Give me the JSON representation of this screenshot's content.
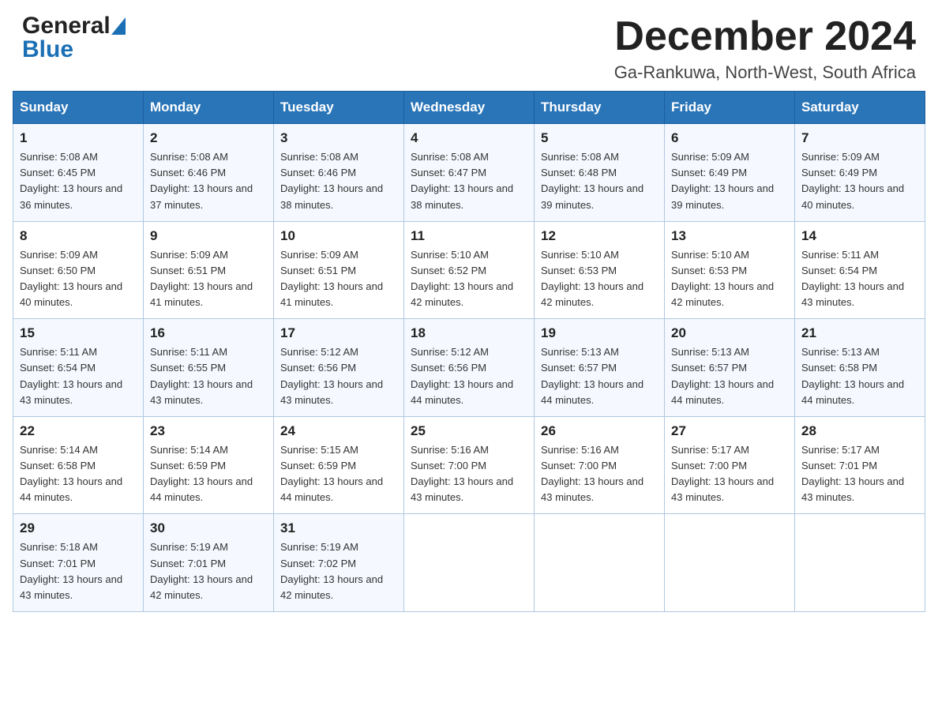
{
  "logo": {
    "general": "General",
    "blue": "Blue"
  },
  "title": {
    "month_year": "December 2024",
    "location": "Ga-Rankuwa, North-West, South Africa"
  },
  "calendar": {
    "headers": [
      "Sunday",
      "Monday",
      "Tuesday",
      "Wednesday",
      "Thursday",
      "Friday",
      "Saturday"
    ],
    "weeks": [
      [
        {
          "day": "1",
          "sunrise": "5:08 AM",
          "sunset": "6:45 PM",
          "daylight": "13 hours and 36 minutes."
        },
        {
          "day": "2",
          "sunrise": "5:08 AM",
          "sunset": "6:46 PM",
          "daylight": "13 hours and 37 minutes."
        },
        {
          "day": "3",
          "sunrise": "5:08 AM",
          "sunset": "6:46 PM",
          "daylight": "13 hours and 38 minutes."
        },
        {
          "day": "4",
          "sunrise": "5:08 AM",
          "sunset": "6:47 PM",
          "daylight": "13 hours and 38 minutes."
        },
        {
          "day": "5",
          "sunrise": "5:08 AM",
          "sunset": "6:48 PM",
          "daylight": "13 hours and 39 minutes."
        },
        {
          "day": "6",
          "sunrise": "5:09 AM",
          "sunset": "6:49 PM",
          "daylight": "13 hours and 39 minutes."
        },
        {
          "day": "7",
          "sunrise": "5:09 AM",
          "sunset": "6:49 PM",
          "daylight": "13 hours and 40 minutes."
        }
      ],
      [
        {
          "day": "8",
          "sunrise": "5:09 AM",
          "sunset": "6:50 PM",
          "daylight": "13 hours and 40 minutes."
        },
        {
          "day": "9",
          "sunrise": "5:09 AM",
          "sunset": "6:51 PM",
          "daylight": "13 hours and 41 minutes."
        },
        {
          "day": "10",
          "sunrise": "5:09 AM",
          "sunset": "6:51 PM",
          "daylight": "13 hours and 41 minutes."
        },
        {
          "day": "11",
          "sunrise": "5:10 AM",
          "sunset": "6:52 PM",
          "daylight": "13 hours and 42 minutes."
        },
        {
          "day": "12",
          "sunrise": "5:10 AM",
          "sunset": "6:53 PM",
          "daylight": "13 hours and 42 minutes."
        },
        {
          "day": "13",
          "sunrise": "5:10 AM",
          "sunset": "6:53 PM",
          "daylight": "13 hours and 42 minutes."
        },
        {
          "day": "14",
          "sunrise": "5:11 AM",
          "sunset": "6:54 PM",
          "daylight": "13 hours and 43 minutes."
        }
      ],
      [
        {
          "day": "15",
          "sunrise": "5:11 AM",
          "sunset": "6:54 PM",
          "daylight": "13 hours and 43 minutes."
        },
        {
          "day": "16",
          "sunrise": "5:11 AM",
          "sunset": "6:55 PM",
          "daylight": "13 hours and 43 minutes."
        },
        {
          "day": "17",
          "sunrise": "5:12 AM",
          "sunset": "6:56 PM",
          "daylight": "13 hours and 43 minutes."
        },
        {
          "day": "18",
          "sunrise": "5:12 AM",
          "sunset": "6:56 PM",
          "daylight": "13 hours and 44 minutes."
        },
        {
          "day": "19",
          "sunrise": "5:13 AM",
          "sunset": "6:57 PM",
          "daylight": "13 hours and 44 minutes."
        },
        {
          "day": "20",
          "sunrise": "5:13 AM",
          "sunset": "6:57 PM",
          "daylight": "13 hours and 44 minutes."
        },
        {
          "day": "21",
          "sunrise": "5:13 AM",
          "sunset": "6:58 PM",
          "daylight": "13 hours and 44 minutes."
        }
      ],
      [
        {
          "day": "22",
          "sunrise": "5:14 AM",
          "sunset": "6:58 PM",
          "daylight": "13 hours and 44 minutes."
        },
        {
          "day": "23",
          "sunrise": "5:14 AM",
          "sunset": "6:59 PM",
          "daylight": "13 hours and 44 minutes."
        },
        {
          "day": "24",
          "sunrise": "5:15 AM",
          "sunset": "6:59 PM",
          "daylight": "13 hours and 44 minutes."
        },
        {
          "day": "25",
          "sunrise": "5:16 AM",
          "sunset": "7:00 PM",
          "daylight": "13 hours and 43 minutes."
        },
        {
          "day": "26",
          "sunrise": "5:16 AM",
          "sunset": "7:00 PM",
          "daylight": "13 hours and 43 minutes."
        },
        {
          "day": "27",
          "sunrise": "5:17 AM",
          "sunset": "7:00 PM",
          "daylight": "13 hours and 43 minutes."
        },
        {
          "day": "28",
          "sunrise": "5:17 AM",
          "sunset": "7:01 PM",
          "daylight": "13 hours and 43 minutes."
        }
      ],
      [
        {
          "day": "29",
          "sunrise": "5:18 AM",
          "sunset": "7:01 PM",
          "daylight": "13 hours and 43 minutes."
        },
        {
          "day": "30",
          "sunrise": "5:19 AM",
          "sunset": "7:01 PM",
          "daylight": "13 hours and 42 minutes."
        },
        {
          "day": "31",
          "sunrise": "5:19 AM",
          "sunset": "7:02 PM",
          "daylight": "13 hours and 42 minutes."
        },
        null,
        null,
        null,
        null
      ]
    ]
  }
}
